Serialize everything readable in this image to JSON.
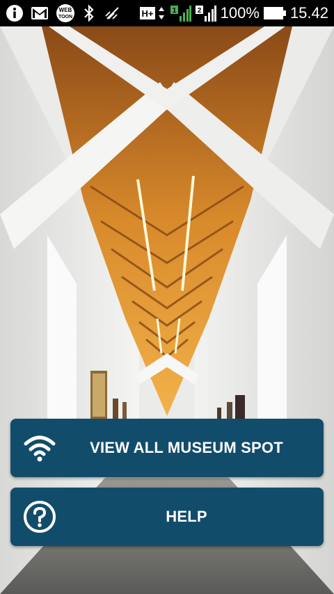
{
  "status_bar": {
    "battery_percent": "100%",
    "time": "15.42",
    "network_type": "H+",
    "sim2_label": "2",
    "sim1_label": "1",
    "icons": [
      "info-icon",
      "gmail-icon",
      "webtoon-icon",
      "bluetooth-icon",
      "mute-icon",
      "network-updown-icon",
      "signal-icon",
      "signal-icon",
      "battery-icon"
    ],
    "webtoon_text": "WEB TOON"
  },
  "menu": {
    "view_all_label": "VIEW ALL MUSEUM SPOT",
    "help_label": "HELP"
  },
  "colors": {
    "button_bg": "#124c6b",
    "status_bar_bg": "#000000",
    "accent_green": "#4caf50"
  }
}
